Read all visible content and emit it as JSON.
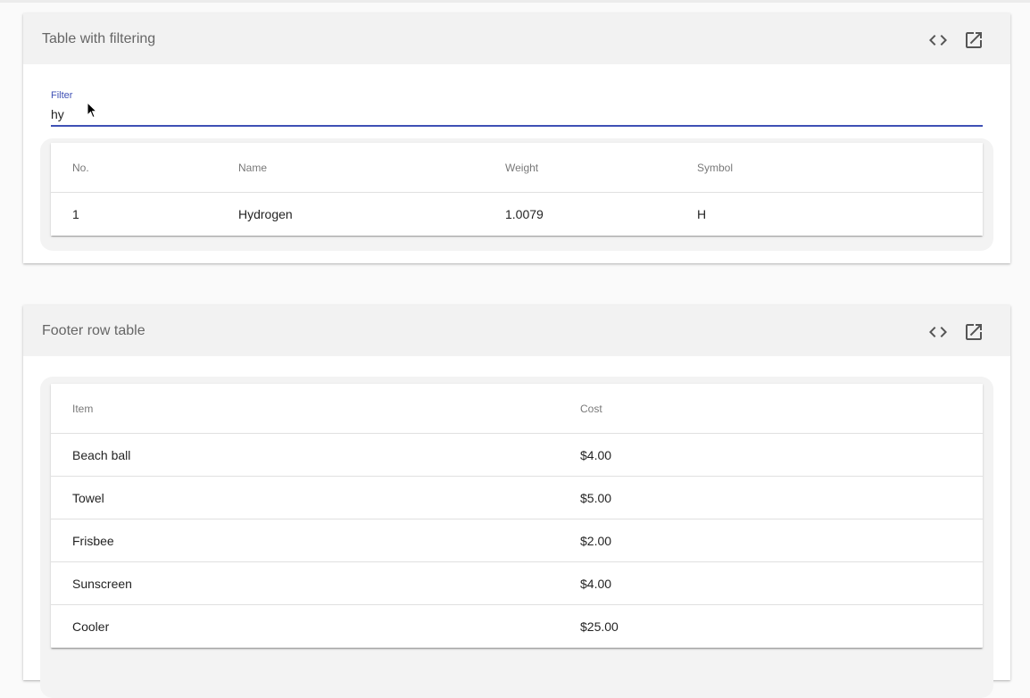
{
  "filter_card": {
    "title": "Table with filtering",
    "filter": {
      "label": "Filter",
      "value": "hy"
    },
    "columns": [
      "No.",
      "Name",
      "Weight",
      "Symbol"
    ],
    "rows": [
      [
        "1",
        "Hydrogen",
        "1.0079",
        "H"
      ]
    ]
  },
  "footer_card": {
    "title": "Footer row table",
    "columns": [
      "Item",
      "Cost"
    ],
    "rows": [
      [
        "Beach ball",
        "$4.00"
      ],
      [
        "Towel",
        "$5.00"
      ],
      [
        "Frisbee",
        "$2.00"
      ],
      [
        "Sunscreen",
        "$4.00"
      ],
      [
        "Cooler",
        "$25.00"
      ]
    ]
  },
  "icons": {
    "code": "code-icon",
    "open_in_new": "open-in-new-icon"
  },
  "colors": {
    "accent": "#3f51b5",
    "header_bg": "#f2f2f2",
    "page_bg": "#fafafa"
  }
}
